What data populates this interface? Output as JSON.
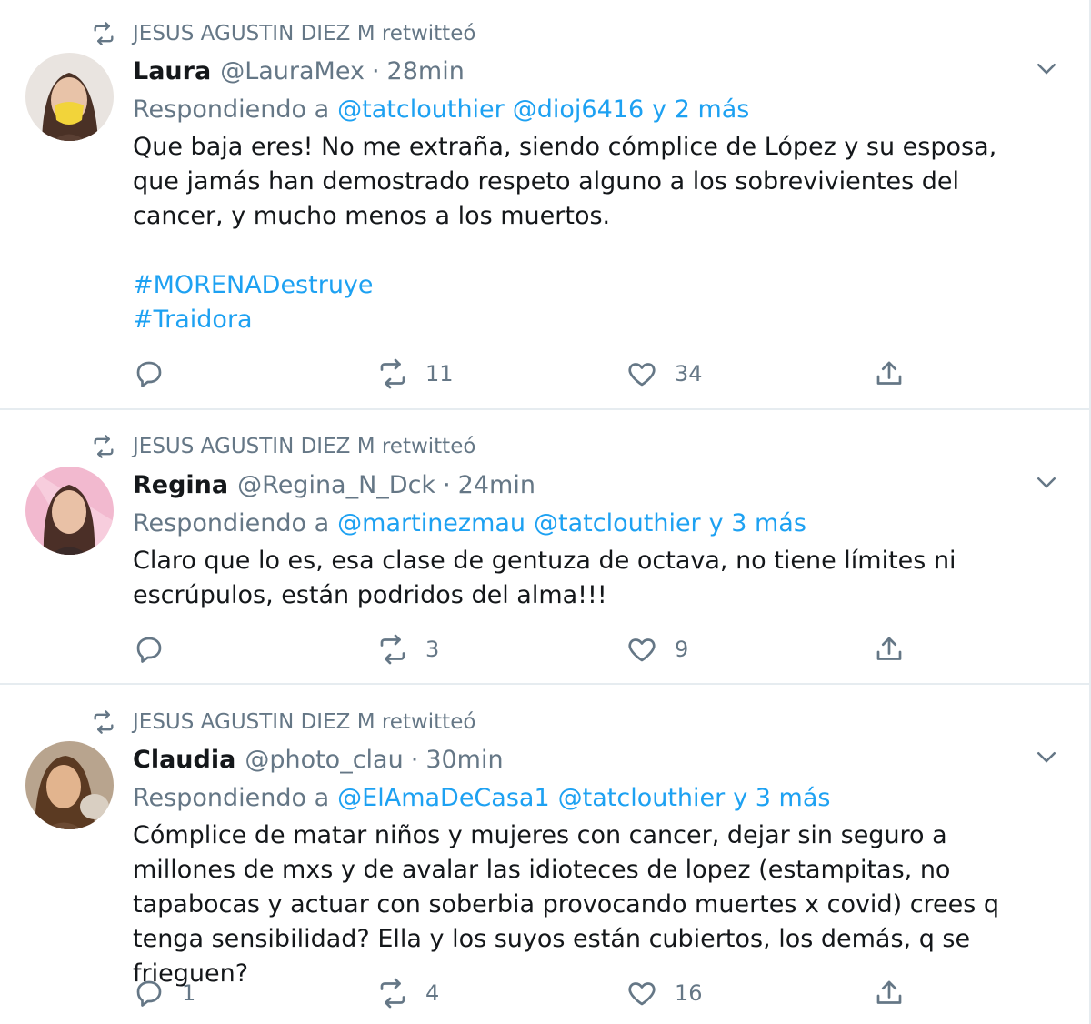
{
  "colors": {
    "link": "#1da1f2",
    "muted": "#657786",
    "text": "#14171a",
    "divider": "#e6ecf0"
  },
  "icons": [
    "retweet-icon",
    "chevron-down-icon",
    "reply-icon",
    "heart-icon",
    "share-icon"
  ],
  "tweets": [
    {
      "retweeted_by": "JESUS AGUSTIN DIEZ M retwitteó",
      "name": "Laura",
      "handle": "@LauraMex",
      "separator": "·",
      "time": "28min",
      "replying_prefix": "Respondiendo a",
      "reply_mentions": [
        "@tatclouthier",
        "@dioj6416"
      ],
      "reply_more": "y 2 más",
      "text": "Que baja eres! No me extraña, siendo cómplice de López y su esposa, que jamás han demostrado respeto alguno a los sobrevivientes del cancer, y mucho menos a los muertos.",
      "hashtags": [
        "#MORENADestruye",
        "#Traidora"
      ],
      "replies": "",
      "retweets": "11",
      "likes": "34"
    },
    {
      "retweeted_by": "JESUS AGUSTIN DIEZ M retwitteó",
      "name": "Regina",
      "handle": "@Regina_N_Dck",
      "separator": "·",
      "time": "24min",
      "replying_prefix": "Respondiendo a",
      "reply_mentions": [
        "@martinezmau",
        "@tatclouthier"
      ],
      "reply_more": "y 3 más",
      "text": "Claro que lo es, esa clase de gentuza de octava, no tiene límites ni escrúpulos, están podridos del alma!!!",
      "hashtags": [],
      "replies": "",
      "retweets": "3",
      "likes": "9"
    },
    {
      "retweeted_by": "JESUS AGUSTIN DIEZ M retwitteó",
      "name": "Claudia",
      "handle": "@photo_clau",
      "separator": "·",
      "time": "30min",
      "replying_prefix": "Respondiendo a",
      "reply_mentions": [
        "@ElAmaDeCasa1",
        "@tatclouthier"
      ],
      "reply_more": "y 3 más",
      "text": "Cómplice de matar niños y mujeres con cancer, dejar sin seguro a millones de mxs y de avalar las idioteces de lopez (estampitas, no tapabocas y actuar con soberbia provocando muertes x covid) crees q tenga sensibilidad? Ella y los suyos están cubiertos, los demás, q se frieguen?",
      "hashtags": [],
      "replies": "1",
      "retweets": "4",
      "likes": "16"
    }
  ]
}
